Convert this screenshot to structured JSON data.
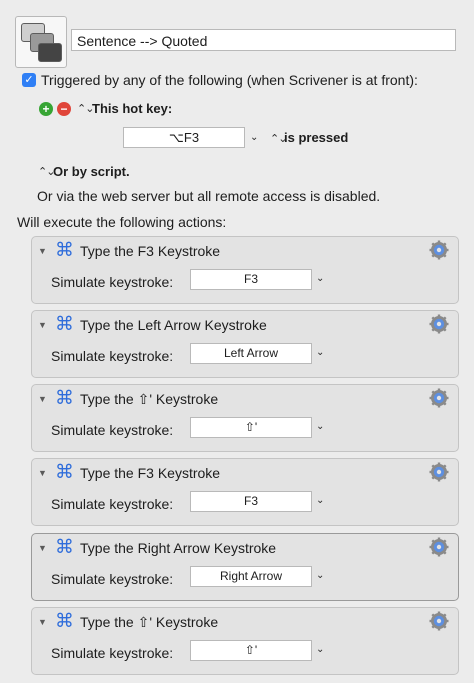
{
  "macro": {
    "name": "Sentence --> Quoted"
  },
  "trigger": {
    "label": "Triggered by any of the following (when Scrivener is at front):",
    "hotkey_heading": "This hot key:",
    "hotkey_value": "⌥F3",
    "hotkey_condition": "is pressed",
    "script_heading": "Or by script.",
    "web_server_note": "Or via the web server but all remote access is disabled."
  },
  "actions_heading": "Will execute the following actions:",
  "actions": [
    {
      "title": "Type the F3 Keystroke",
      "label": "Simulate keystroke:",
      "keystroke": "F3"
    },
    {
      "title": "Type the Left Arrow Keystroke",
      "label": "Simulate keystroke:",
      "keystroke": "Left Arrow"
    },
    {
      "title": "Type the ⇧' Keystroke",
      "label": "Simulate keystroke:",
      "keystroke": "⇧'"
    },
    {
      "title": "Type the F3 Keystroke",
      "label": "Simulate keystroke:",
      "keystroke": "F3"
    },
    {
      "title": "Type the Right Arrow Keystroke",
      "label": "Simulate keystroke:",
      "keystroke": "Right Arrow"
    },
    {
      "title": "Type the ⇧' Keystroke",
      "label": "Simulate keystroke:",
      "keystroke": "⇧'"
    }
  ],
  "icons": {
    "checkbox": "✓",
    "plus": "+",
    "minus": "−",
    "updown": "⌃⌄",
    "chevron": "⌄",
    "disclosure": "▼",
    "command": "⌘"
  },
  "colors": {
    "accent": "#2f7ff5",
    "add": "#37a534",
    "remove": "#e0453a",
    "command_icon": "#2f6ddb"
  }
}
